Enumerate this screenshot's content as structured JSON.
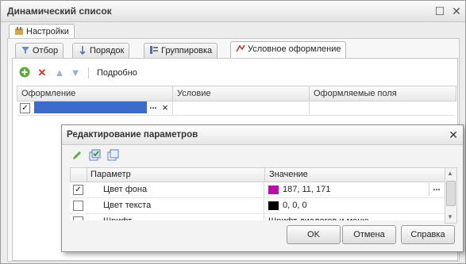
{
  "window": {
    "title": "Динамический список"
  },
  "outer_tab": {
    "label": "Настройки"
  },
  "tabs": [
    {
      "label": "Отбор",
      "active": false
    },
    {
      "label": "Порядок",
      "active": false
    },
    {
      "label": "Группировка",
      "active": false
    },
    {
      "label": "Условное оформление",
      "active": true
    }
  ],
  "toolbar": {
    "details_label": "Подробно"
  },
  "grid": {
    "columns": [
      "Оформление",
      "Условие",
      "Оформляемые поля"
    ],
    "row": {
      "checked": true,
      "ellipsis": "...",
      "clear": "×"
    }
  },
  "dialog": {
    "title": "Редактирование параметров",
    "columns": [
      "Параметр",
      "Значение"
    ],
    "rows": [
      {
        "checked": true,
        "param": "Цвет фона",
        "swatch": "#bb0bab",
        "value": "187, 11, 171"
      },
      {
        "checked": false,
        "param": "Цвет текста",
        "swatch": "#000000",
        "value": "0, 0, 0"
      },
      {
        "checked": false,
        "param": "Шрифт",
        "swatch": "",
        "value": "Шрифт диалогов и меню"
      }
    ],
    "ok_label": "OK",
    "cancel_label": "Отмена",
    "help_label": "Справка"
  },
  "colors": {
    "accent": "#3d6bcb",
    "window_bg": "#ececec"
  }
}
